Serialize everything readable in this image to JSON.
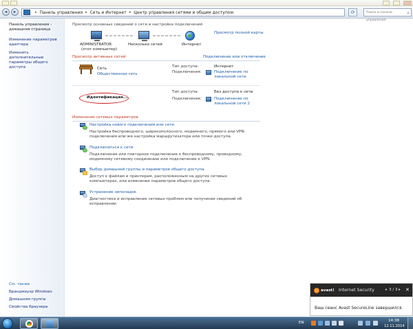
{
  "address_bar": {
    "crumbs": [
      "Панель управления",
      "Сеть и Интернет",
      "Центр управления сетями и общим доступом"
    ],
    "search_placeholder": "Поиск в панели управления"
  },
  "left_pane": {
    "links": [
      "Панель управления - домашняя страница",
      "Изменение параметров адаптера",
      "Изменить дополнительные параметры общего доступа"
    ],
    "see_also_heading": "См. также",
    "see_also": [
      "Брандмауэр Windows",
      "Домашняя группа",
      "Свойства браузера"
    ]
  },
  "main": {
    "heading": "Просмотр основных сведений о сети и настройка подключений",
    "full_map_link": "Просмотр полной карты",
    "map": {
      "node1_name": "ADMINISTRATOR",
      "node1_sub": "(этот компьютер)",
      "node2_name": "Несколько сетей",
      "node3_name": "Интернет"
    },
    "active_networks_heading": "Просмотр активных сетей",
    "connect_link": "Подключение или отключение",
    "network1": {
      "name": "Сеть",
      "type_link": "Общественная сеть",
      "access_label": "Тип доступа:",
      "access_value": "Интернет",
      "conn_label": "Подключения:",
      "conn_value": "Подключение по локальной сети"
    },
    "network2": {
      "identifying": "Идентификация...",
      "access_label": "Тип доступа:",
      "access_value": "Без доступа к сети",
      "conn_label": "Подключения:",
      "conn_value": "Подключение по локальной сети 2"
    },
    "change_heading": "Изменение сетевых параметров",
    "tasks": [
      {
        "title": "Настройка нового подключения или сети",
        "desc": "Настройка беспроводного, широкополосного, модемного, прямого или VPN-подключения или же настройка маршрутизатора или точки доступа."
      },
      {
        "title": "Подключиться к сети",
        "desc": "Подключение или повторное подключение к беспроводному, проводному, модемному сетевому соединению или подключение к VPN."
      },
      {
        "title": "Выбор домашней группы и параметров общего доступа",
        "desc": "Доступ к файлам и принтерам, расположенным на других сетевых компьютерах, или изменение параметров общего доступа."
      },
      {
        "title": "Устранение неполадок",
        "desc": "Диагностика и исправление сетевых проблем или получение сведений об исправлении."
      }
    ]
  },
  "notification": {
    "brand": "avast!",
    "title": "Internet Security",
    "prev": "◂",
    "count": "3 / 3",
    "next": "▸",
    "close": "✕",
    "message": "Ваш сеанс Avast SecureLine завершился."
  },
  "taskbar": {
    "lang": "EN",
    "time": "14:38",
    "date": "12.11.2014"
  },
  "colors": {
    "link": "#1a5aa8",
    "red_heading": "#c03a20",
    "ellipse": "#cc1d1d",
    "taskbar": "#2f4f6e"
  }
}
